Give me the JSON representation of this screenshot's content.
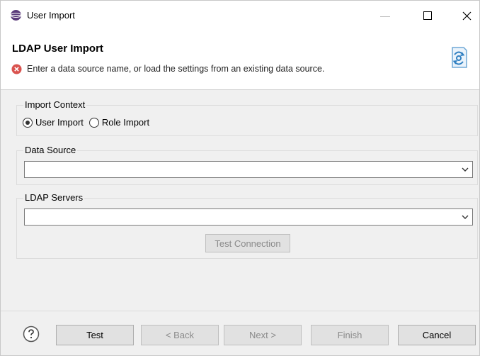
{
  "window": {
    "title": "User Import",
    "min_icon": "minimize-icon",
    "max_icon": "maximize-icon",
    "close_icon": "close-icon"
  },
  "header": {
    "title": "LDAP User Import",
    "message": "Enter a data source name, or load the settings from an existing data source.",
    "error_icon": "error-icon",
    "wizard_icon": "import-wizard-icon"
  },
  "import_context": {
    "legend": "Import Context",
    "options": [
      {
        "label": "User Import",
        "checked": true
      },
      {
        "label": "Role Import",
        "checked": false
      }
    ]
  },
  "data_source": {
    "legend": "Data Source",
    "value": ""
  },
  "ldap_servers": {
    "legend": "LDAP Servers",
    "value": "",
    "test_connection": "Test Connection"
  },
  "footer": {
    "help_icon": "help-icon",
    "test": "Test",
    "back": "< Back",
    "next": "Next >",
    "finish": "Finish",
    "cancel": "Cancel"
  },
  "colors": {
    "error_red": "#d9534f",
    "wizard_blue": "#2f7fc1"
  }
}
